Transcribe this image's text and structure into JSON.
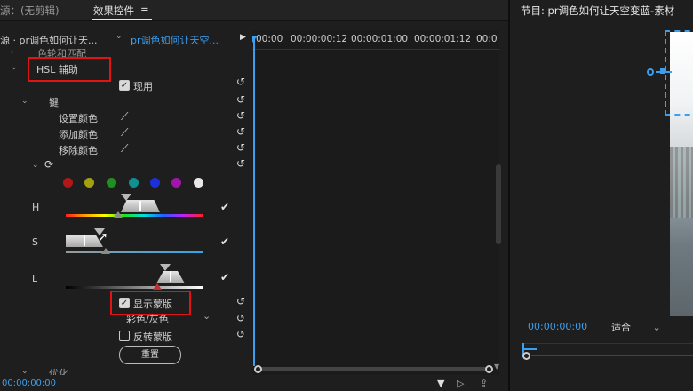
{
  "tabs": {
    "source": "源：(无剪辑)",
    "effects": "效果控件",
    "effects_menu": "≡",
    "program": "节目: pr调色如何让天空变蓝-素材",
    "program_menu": "≡"
  },
  "clip": {
    "master": "源 · pr调色如何让天...",
    "sequence": "pr调色如何让天空..."
  },
  "timecodes": [
    "00:00",
    "00:00:00:12",
    "00:00:01:00",
    "00:00:01:12",
    "00:0"
  ],
  "properties": {
    "partial_top": "色轮和匹配",
    "hsl_label": "HSL 辅助",
    "enabled_label": "现用",
    "key_label": "键",
    "set_color": "设置颜色",
    "add_color": "添加颜色",
    "remove_color": "移除颜色",
    "h_label": "H",
    "s_label": "S",
    "l_label": "L",
    "show_mask": "显示蒙版",
    "mask_mode": "彩色/灰色",
    "invert_mask": "反转蒙版",
    "reset_button": "重置",
    "partial_bottom": "优化"
  },
  "color_swatches": [
    "#b01818",
    "#a0a010",
    "#1f8f20",
    "#109090",
    "#1c2fd8",
    "#a016a8",
    "#e8e8e8"
  ],
  "bottom": {
    "timecode": "00:00:00:00"
  },
  "program": {
    "timecode": "00:00:00:00",
    "fit": "适合"
  }
}
